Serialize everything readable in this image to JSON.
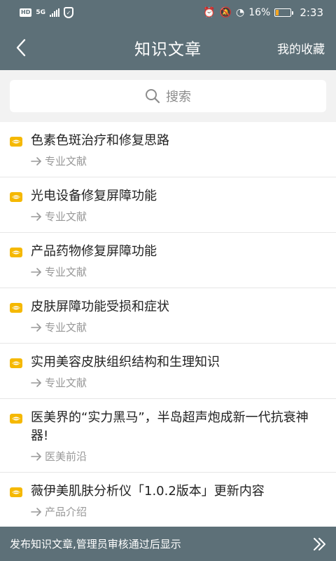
{
  "status_bar": {
    "badge": "HD",
    "network": "5G",
    "battery_percent": "16%",
    "battery_level": 0.16,
    "time": "2:33",
    "icons": [
      "signal-icon",
      "shield-icon",
      "alarm-off-icon",
      "mute-icon",
      "speed-icon",
      "battery-icon"
    ]
  },
  "header": {
    "title": "知识文章",
    "favorites_label": "我的收藏",
    "back_icon": "chevron-left-icon"
  },
  "search": {
    "placeholder": "搜索",
    "icon": "search-icon"
  },
  "articles": [
    {
      "title": "色素色斑治疗和修复思路",
      "category": "专业文献"
    },
    {
      "title": "光电设备修复屏障功能",
      "category": "专业文献"
    },
    {
      "title": "产品药物修复屏障功能",
      "category": "专业文献"
    },
    {
      "title": "皮肤屏障功能受损和症状",
      "category": "专业文献"
    },
    {
      "title": "实用美容皮肤组织结构和生理知识",
      "category": "专业文献"
    },
    {
      "title": "医美界的“实力黑马”，半岛超声炮成新一代抗衰神器!",
      "category": "医美前沿"
    },
    {
      "title": "薇伊美肌肤分析仪「1.0.2版本」更新内容",
      "category": "产品介绍"
    }
  ],
  "banner": {
    "text": "发布知识文章,管理员审核通过后显示",
    "icon": "double-chevron-right-icon"
  },
  "colors": {
    "header": "#5d7078",
    "accent": "#f5b800",
    "text": "#222222",
    "muted": "#999999"
  }
}
